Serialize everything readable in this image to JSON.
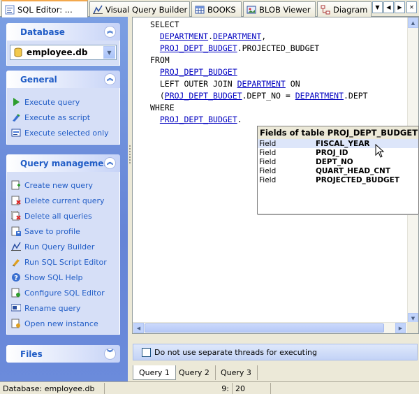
{
  "tabs": [
    {
      "label": "SQL Editor: ...",
      "icon": "sql-editor-icon",
      "active": true
    },
    {
      "label": "Visual Query Builder",
      "icon": "query-builder-icon"
    },
    {
      "label": "BOOKS",
      "icon": "table-icon"
    },
    {
      "label": "BLOB Viewer",
      "icon": "blob-viewer-icon"
    },
    {
      "label": "Diagram",
      "icon": "diagram-icon"
    }
  ],
  "tab_nav": {
    "down": "▼",
    "left": "◀",
    "right": "▶",
    "close": "✕"
  },
  "database_panel": {
    "title": "Database",
    "selected_db": "employee.db"
  },
  "general_panel": {
    "title": "General",
    "items": [
      {
        "label": "Execute query",
        "icon": "play-icon"
      },
      {
        "label": "Execute as script",
        "icon": "script-icon"
      },
      {
        "label": "Execute selected only",
        "icon": "execute-selected-icon"
      }
    ]
  },
  "query_panel": {
    "title": "Query management",
    "items": [
      {
        "label": "Create new query",
        "icon": "new-query-icon"
      },
      {
        "label": "Delete current query",
        "icon": "delete-query-icon"
      },
      {
        "label": "Delete all queries",
        "icon": "delete-all-icon"
      },
      {
        "label": "Save to profile",
        "icon": "save-profile-icon"
      },
      {
        "label": "Run Query Builder",
        "icon": "query-builder-icon"
      },
      {
        "label": "Run SQL Script Editor",
        "icon": "script-editor-icon"
      },
      {
        "label": "Show SQL Help",
        "icon": "help-icon"
      },
      {
        "label": "Configure SQL Editor",
        "icon": "configure-icon"
      },
      {
        "label": "Rename query",
        "icon": "rename-icon"
      },
      {
        "label": "Open new instance",
        "icon": "new-instance-icon"
      }
    ]
  },
  "files_panel": {
    "title": "Files"
  },
  "code": {
    "lines": [
      [
        {
          "t": "SELECT"
        }
      ],
      [
        {
          "t": "  "
        },
        {
          "t": "DEPARTMENT",
          "tbl": true
        },
        {
          "t": "."
        },
        {
          "t": "DEPARTMENT",
          "tbl": true
        },
        {
          "t": ","
        }
      ],
      [
        {
          "t": "  "
        },
        {
          "t": "PROJ_DEPT_BUDGET",
          "tbl": true
        },
        {
          "t": ".PROJECTED_BUDGET"
        }
      ],
      [
        {
          "t": "FROM"
        }
      ],
      [
        {
          "t": "  "
        },
        {
          "t": "PROJ_DEPT_BUDGET",
          "tbl": true
        }
      ],
      [
        {
          "t": "  LEFT OUTER JOIN "
        },
        {
          "t": "DEPARTMENT",
          "tbl": true
        },
        {
          "t": " ON"
        }
      ],
      [
        {
          "t": "  ("
        },
        {
          "t": "PROJ_DEPT_BUDGET",
          "tbl": true
        },
        {
          "t": ".DEPT_NO = "
        },
        {
          "t": "DEPARTMENT",
          "tbl": true
        },
        {
          "t": ".DEPT"
        }
      ],
      [
        {
          "t": "WHERE"
        }
      ],
      [
        {
          "t": "  "
        },
        {
          "t": "PROJ_DEPT_BUDGET",
          "tbl": true
        },
        {
          "t": "."
        }
      ]
    ]
  },
  "autocomplete": {
    "title": "Fields of table PROJ_DEPT_BUDGET",
    "rows": [
      {
        "kind": "Field",
        "name": "FISCAL_YEAR",
        "selected": true
      },
      {
        "kind": "Field",
        "name": "PROJ_ID"
      },
      {
        "kind": "Field",
        "name": "DEPT_NO"
      },
      {
        "kind": "Field",
        "name": "QUART_HEAD_CNT"
      },
      {
        "kind": "Field",
        "name": "PROJECTED_BUDGET"
      }
    ]
  },
  "threads_checkbox": {
    "label": "Do not use separate threads for executing",
    "checked": false
  },
  "query_tabs": [
    "Query 1",
    "Query 2",
    "Query 3"
  ],
  "active_query_tab": 0,
  "status": {
    "database": "Database: employee.db",
    "line": "9:",
    "col": "20"
  },
  "colors": {
    "accent": "#215dc6",
    "sql_table_link": "#0000c0",
    "pane_bg": "#6b8bdb"
  }
}
